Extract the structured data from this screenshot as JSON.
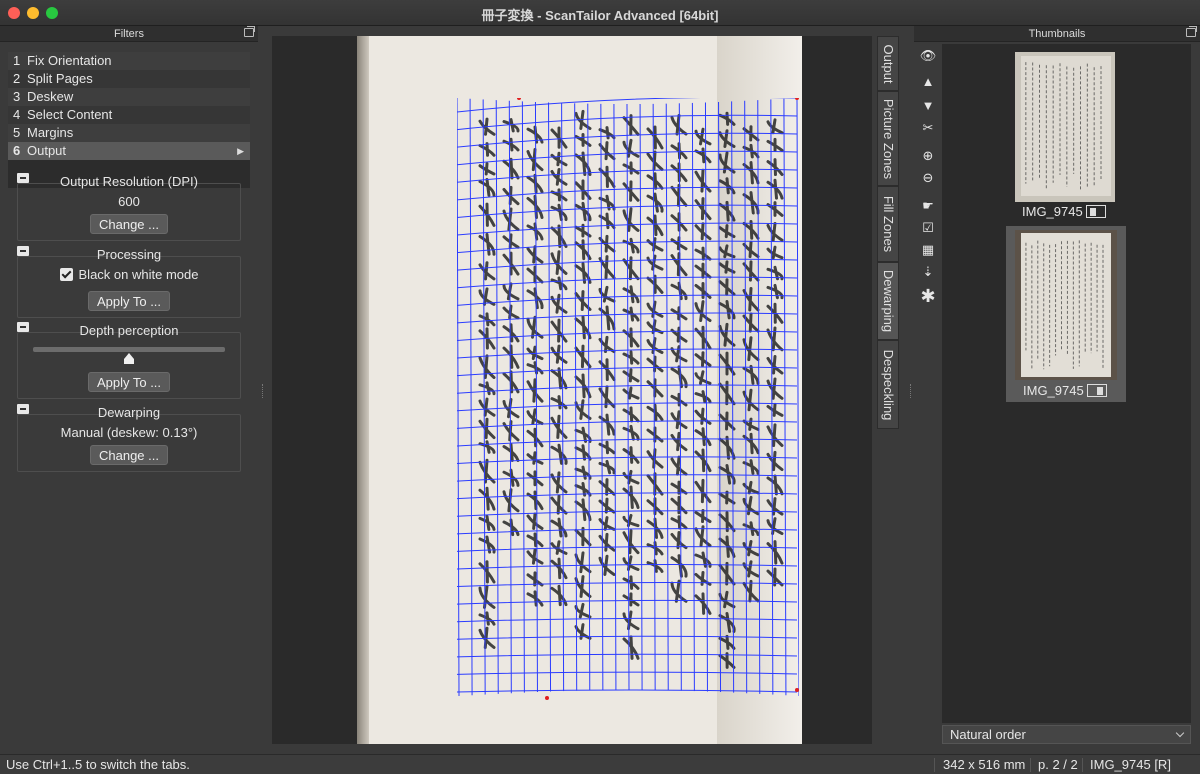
{
  "window": {
    "title": "冊子変換 - ScanTailor Advanced [64bit]"
  },
  "filters_dock": {
    "title": "Filters",
    "items": [
      {
        "num": "1",
        "label": "Fix Orientation"
      },
      {
        "num": "2",
        "label": "Split Pages"
      },
      {
        "num": "3",
        "label": "Deskew"
      },
      {
        "num": "4",
        "label": "Select Content"
      },
      {
        "num": "5",
        "label": "Margins"
      },
      {
        "num": "6",
        "label": "Output",
        "selected": true
      }
    ]
  },
  "output_resolution": {
    "title": "Output Resolution (DPI)",
    "value": "600",
    "button": "Change ..."
  },
  "processing": {
    "title": "Processing",
    "checkbox_label": "Black on white mode",
    "checked": true,
    "button": "Apply To ..."
  },
  "depth_perception": {
    "title": "Depth perception",
    "button": "Apply To ..."
  },
  "dewarping": {
    "title": "Dewarping",
    "mode": "Manual (deskew: 0.13°)",
    "button": "Change ..."
  },
  "side_tabs": [
    "Output",
    "Picture Zones",
    "Fill Zones",
    "Dewarping",
    "Despeckling"
  ],
  "active_side_tab": "Dewarping",
  "thumbnails_dock": {
    "title": "Thumbnails",
    "items": [
      {
        "label": "IMG_9745"
      },
      {
        "label": "IMG_9745"
      }
    ],
    "order": "Natural order"
  },
  "statusbar": {
    "hint": "Use Ctrl+1..5 to switch the tabs.",
    "physical_size": "342 x 516 mm",
    "page": "p. 2 / 2",
    "file": "IMG_9745 [R]"
  },
  "colors": {
    "grid": "#2b3cff",
    "background": "#3a3a3a",
    "selected": "#5a5a5a"
  },
  "tool_icons": [
    "eye-icon",
    "arrow-up-icon",
    "arrow-down-icon",
    "cut-icon",
    "zoom-in-icon",
    "zoom-out-icon",
    "pointer-icon",
    "checkbox-icon",
    "grid-icon",
    "sort-icon",
    "asterisk-icon"
  ]
}
